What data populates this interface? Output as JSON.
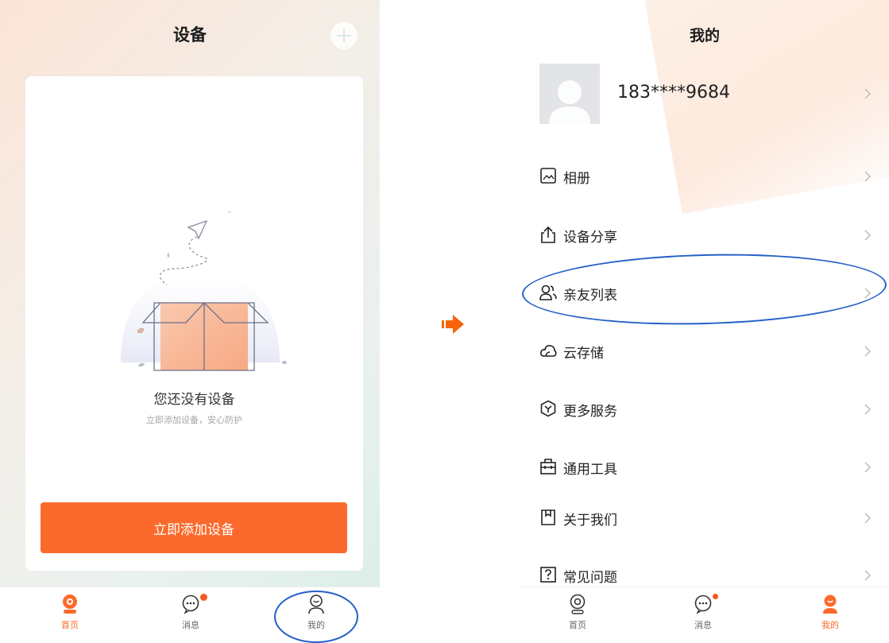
{
  "left_screen": {
    "title": "设备",
    "add_icon": "plus-icon",
    "empty_title": "您还没有设备",
    "empty_subtitle": "立即添加设备，安心防护",
    "add_button_label": "立即添加设备"
  },
  "right_screen": {
    "title": "我的",
    "phone": "183****9684",
    "menu": [
      {
        "label": "相册",
        "icon": "album-icon"
      },
      {
        "label": "设备分享",
        "icon": "share-icon"
      },
      {
        "label": "亲友列表",
        "icon": "friends-icon"
      },
      {
        "label": "云存储",
        "icon": "cloud-icon"
      },
      {
        "label": "更多服务",
        "icon": "services-icon"
      },
      {
        "label": "通用工具",
        "icon": "toolbox-icon"
      },
      {
        "label": "关于我们",
        "icon": "about-icon"
      },
      {
        "label": "常见问题",
        "icon": "faq-icon"
      }
    ]
  },
  "tabs": {
    "home": "首页",
    "messages": "消息",
    "mine": "我的"
  },
  "colors": {
    "accent": "#fb6a2c",
    "annotation": "#2460c8",
    "badge": "#f15a22"
  }
}
